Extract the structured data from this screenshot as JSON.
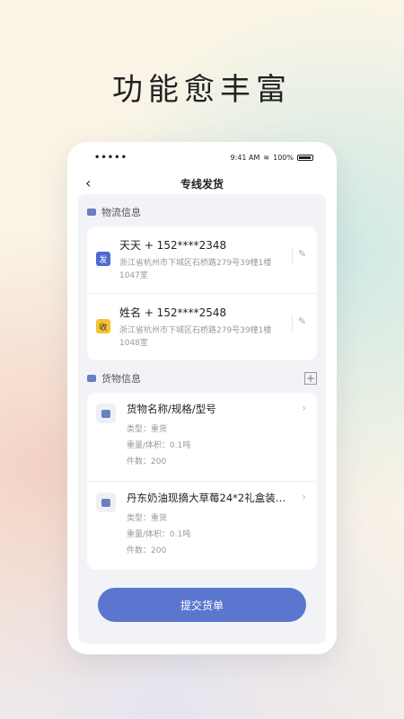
{
  "headline": "功能愈丰富",
  "status_bar": {
    "signal": "•••••",
    "time": "9:41 AM",
    "battery": "100%"
  },
  "nav": {
    "title": "专线发货"
  },
  "logistics": {
    "section_label": "物流信息",
    "sender": {
      "badge": "发",
      "name_phone": "天天 + 152****2348",
      "address": "浙江省杭州市下城区石桥路279号39幢1楼1047室"
    },
    "receiver": {
      "badge": "收",
      "name_phone": "姓名 + 152****2548",
      "address": "浙江省杭州市下城区石桥路279号39幢1楼1048室"
    }
  },
  "goods": {
    "section_label": "货物信息",
    "items": [
      {
        "title": "货物名称/规格/型号",
        "type": "类型：重货",
        "weight": "重量/体积：0.1吨",
        "count": "件数：200"
      },
      {
        "title": "丹东奶油现摘大草莓24*2礼盒装…",
        "type": "类型：重货",
        "weight": "重量/体积：0.1吨",
        "count": "件数：200"
      }
    ]
  },
  "submit_label": "提交货单"
}
